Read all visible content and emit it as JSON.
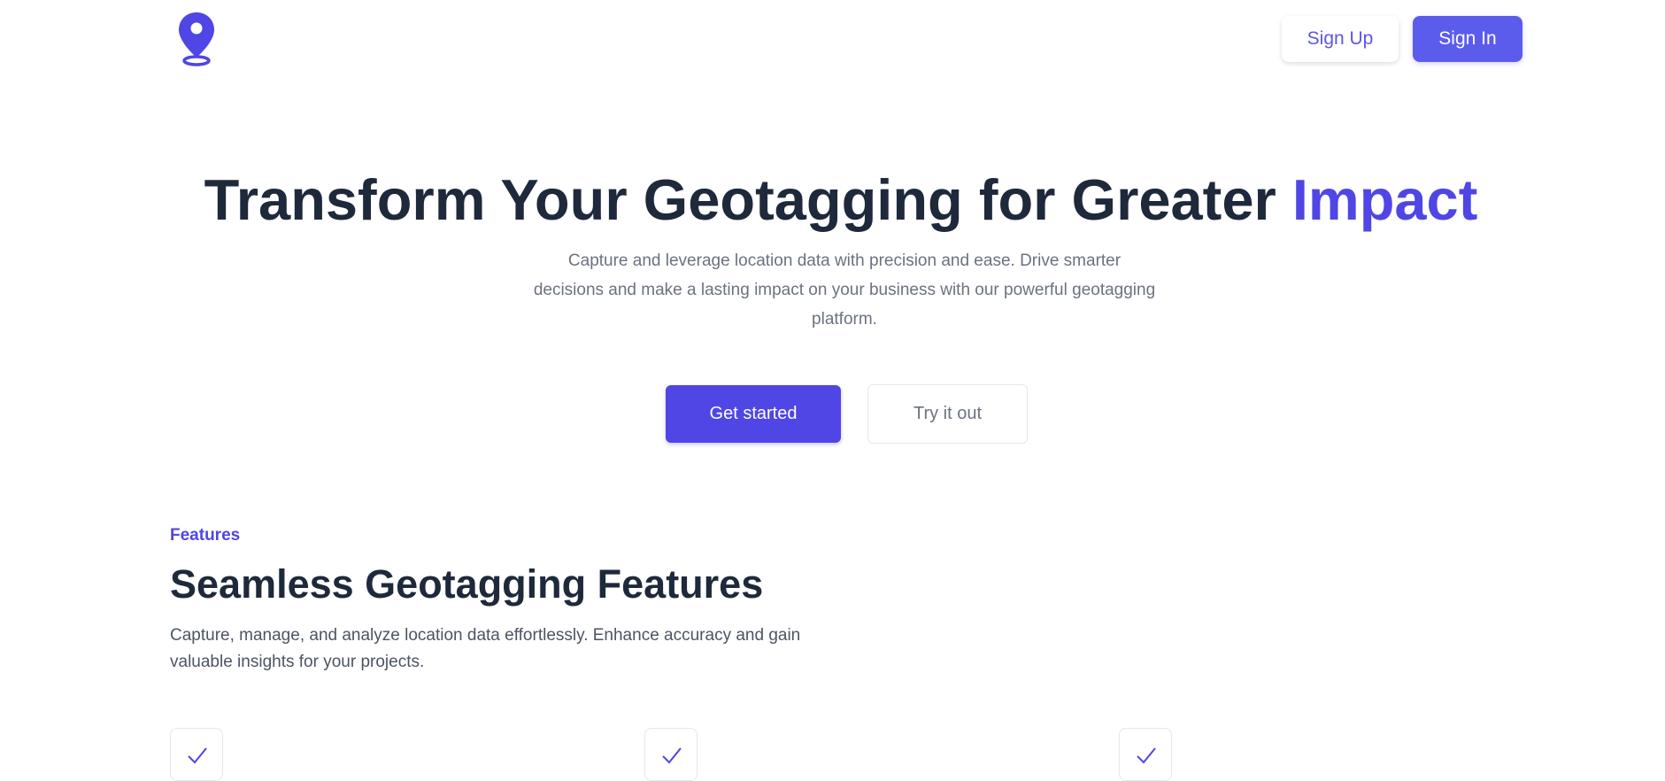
{
  "header": {
    "logo_icon": "map-pin-icon",
    "signup_label": "Sign Up",
    "signin_label": "Sign In"
  },
  "hero": {
    "title_main": "Transform Your Geotagging for Greater ",
    "title_accent": "Impact",
    "subtitle": "Capture and leverage location data with precision and ease. Drive smarter decisions and make a lasting impact on your business with our powerful geotagging platform.",
    "primary_cta": "Get started",
    "secondary_cta": "Try it out"
  },
  "features": {
    "eyebrow": "Features",
    "title": "Seamless Geotagging Features",
    "description": "Capture, manage, and analyze location data effortlessly. Enhance accuracy and gain valuable insights for your projects.",
    "items": [
      {
        "icon": "check-icon"
      },
      {
        "icon": "check-icon"
      },
      {
        "icon": "check-icon"
      }
    ]
  },
  "colors": {
    "accent": "#4f46e5",
    "signin_bg": "#5b5cec",
    "heading": "#1e293b",
    "muted": "#6b7280"
  }
}
